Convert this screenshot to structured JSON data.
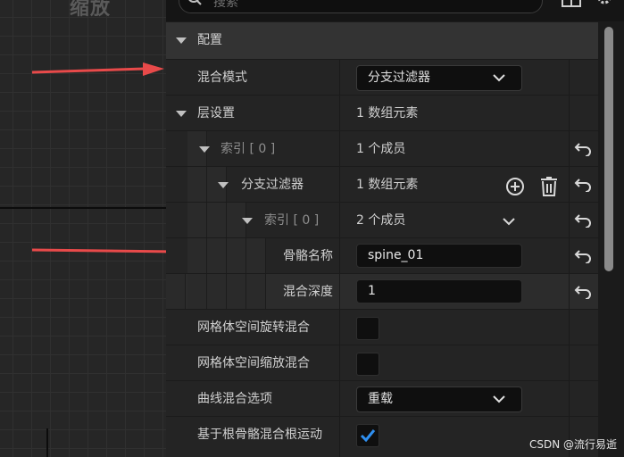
{
  "graph": {
    "title": "缩放"
  },
  "search": {
    "placeholder": "搜索"
  },
  "panel": {
    "section_config": "配置",
    "blend_mode": {
      "label": "混合模式",
      "value": "分支过滤器"
    },
    "layer_setup": {
      "label": "层设置",
      "value": "1 数组元素"
    },
    "index0": {
      "label": "索引 [ 0 ]",
      "value": "1 个成员"
    },
    "branch_filters": {
      "label": "分支过滤器",
      "value": "1 数组元素"
    },
    "inner_index0": {
      "label": "索引 [ 0 ]",
      "value": "2 个成员"
    },
    "bone_name": {
      "label": "骨骼名称",
      "value": "spine_01"
    },
    "blend_depth": {
      "label": "混合深度",
      "value": "1"
    },
    "mesh_space_rotation": {
      "label": "网格体空间旋转混合",
      "checked": false
    },
    "mesh_space_scale": {
      "label": "网格体空间缩放混合",
      "checked": false
    },
    "curve_blend": {
      "label": "曲线混合选项",
      "value": "重载"
    },
    "root_motion": {
      "label": "基于根骨骼混合根运动",
      "checked": true
    }
  },
  "colors": {
    "arrow": "#e84a4a",
    "check": "#2f8ff0"
  },
  "watermark": "CSDN @流行易逝"
}
